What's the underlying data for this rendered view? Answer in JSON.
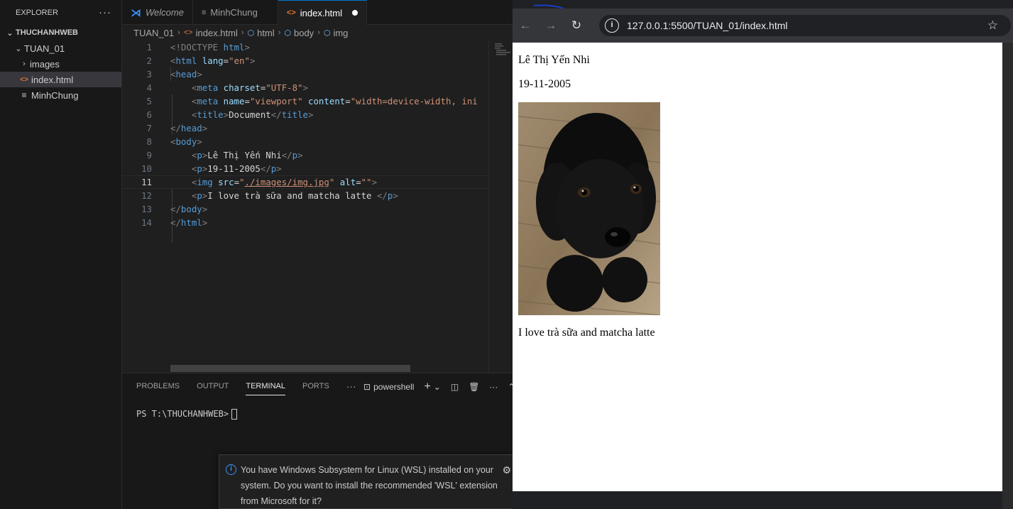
{
  "explorer": {
    "title": "EXPLORER",
    "more": "···",
    "workspace": "THUCHANHWEB",
    "folder": "TUAN_01",
    "items": [
      {
        "label": "images",
        "type": "folder"
      },
      {
        "label": "index.html",
        "type": "html",
        "selected": true
      },
      {
        "label": "MinhChung",
        "type": "text"
      }
    ]
  },
  "tabs": [
    {
      "label": "Welcome",
      "icon": "vscode-icon"
    },
    {
      "label": "MinhChung",
      "icon": "lines-icon"
    },
    {
      "label": "index.html",
      "icon": "html-icon",
      "active": true,
      "modified": true
    }
  ],
  "breadcrumb": [
    "TUAN_01",
    "index.html",
    "html",
    "body",
    "img"
  ],
  "code": {
    "current_line": 11,
    "lines": [
      {
        "n": "1"
      },
      {
        "n": "2"
      },
      {
        "n": "3"
      },
      {
        "n": "4"
      },
      {
        "n": "5"
      },
      {
        "n": "6"
      },
      {
        "n": "7"
      },
      {
        "n": "8"
      },
      {
        "n": "9"
      },
      {
        "n": "10"
      },
      {
        "n": "11"
      },
      {
        "n": "12"
      },
      {
        "n": "13"
      },
      {
        "n": "14"
      }
    ],
    "tokens": {
      "doctype": "<!DOCTYPE ",
      "html_kw": "html",
      "lang_attr": "lang",
      "lang_val": "\"en\"",
      "charset_attr": "charset",
      "charset_val": "\"UTF-8\"",
      "name_attr": "name",
      "name_val": "\"viewport\"",
      "content_attr": "content",
      "content_val": "\"width=device-width, ini",
      "title_text": "Document",
      "p1_text": "Lê Thị Yến Nhi",
      "p2_text": "19-11-2005",
      "src_attr": "src",
      "src_q1": "\"",
      "src_val": "./images/img.jpg",
      "src_q2": "\"",
      "alt_attr": "alt",
      "alt_val": "\"\"",
      "p3_text": "I love trà sữa and matcha latte "
    }
  },
  "panel": {
    "tabs": [
      "PROBLEMS",
      "OUTPUT",
      "TERMINAL",
      "PORTS"
    ],
    "active_tab": "TERMINAL",
    "more": "···",
    "shell": "powershell",
    "prompt": "PS T:\\THUCHANHWEB>"
  },
  "notification": {
    "message": "You have Windows Subsystem for Linux (WSL) installed on your system. Do you want to install the recommended 'WSL' extension from Microsoft for it?"
  },
  "browser": {
    "url": "127.0.0.1:5500/TUAN_01/index.html",
    "page": {
      "name": "Lê Thị Yến Nhi",
      "date": "19-11-2005",
      "image_alt": "",
      "image_subject": "black puppy on wooden floor",
      "caption": "I love trà sữa and matcha latte"
    }
  },
  "colors": {
    "accent": "#0078d4",
    "tag": "#569cd6",
    "attribute": "#9cdcfe",
    "string": "#ce9178",
    "html_icon": "#e37933"
  }
}
